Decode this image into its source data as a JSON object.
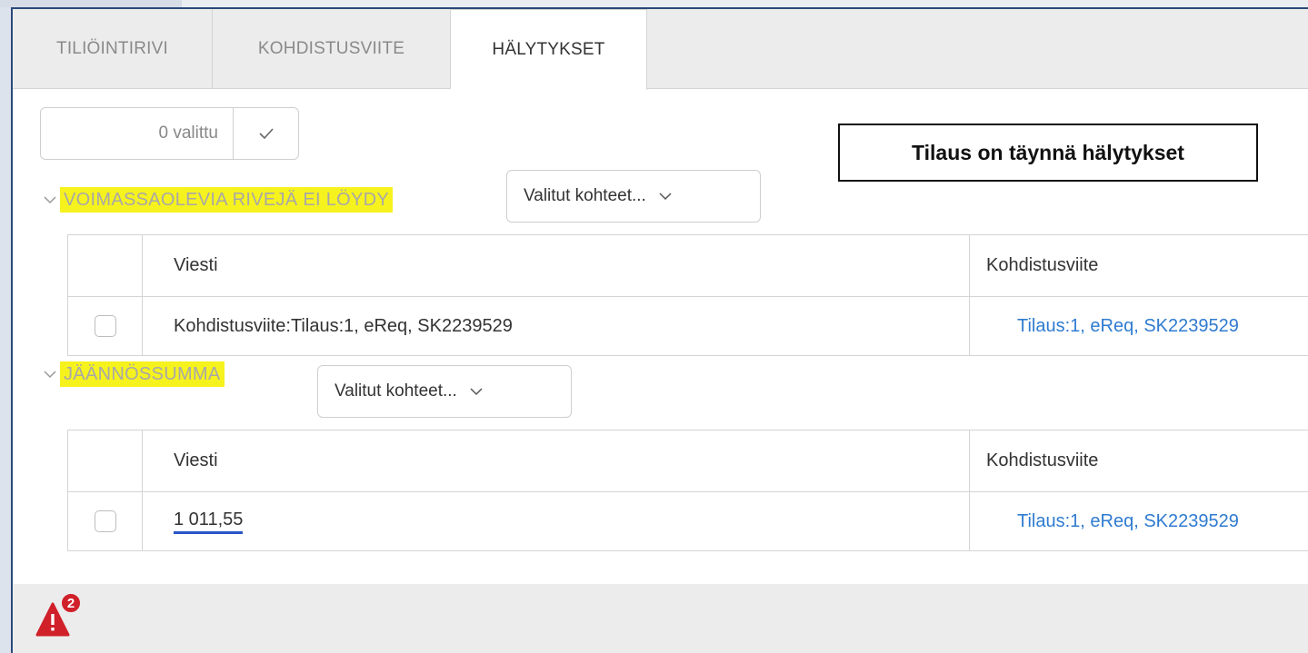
{
  "tabs": [
    {
      "label": "TILIÖINTIRIVI"
    },
    {
      "label": "KOHDISTUSVIITE"
    },
    {
      "label": "HÄLYTYKSET"
    }
  ],
  "selection": {
    "count_label": "0 valittu"
  },
  "callout": {
    "text": "Tilaus on täynnä hälytykset"
  },
  "groups": [
    {
      "title": "VOIMASSAOLEVIA RIVEJÄ EI LÖYDY",
      "filter_label": "Valitut kohteet...",
      "columns": [
        "Viesti",
        "Kohdistusviite"
      ],
      "rows": [
        {
          "message": "Kohdistusviite:Tilaus:1, eReq, SK2239529",
          "reference": "Tilaus:1, eReq, SK2239529"
        }
      ]
    },
    {
      "title": "JÄÄNNÖSSUMMA",
      "filter_label": "Valitut kohteet...",
      "columns": [
        "Viesti",
        "Kohdistusviite"
      ],
      "rows": [
        {
          "message": "1 011,55",
          "reference": "Tilaus:1, eReq, SK2239529"
        }
      ]
    }
  ],
  "footer": {
    "alert_count": "2"
  },
  "colors": {
    "highlight": "#f6f21e",
    "link": "#2f7bd0",
    "alert": "#d0202a"
  }
}
